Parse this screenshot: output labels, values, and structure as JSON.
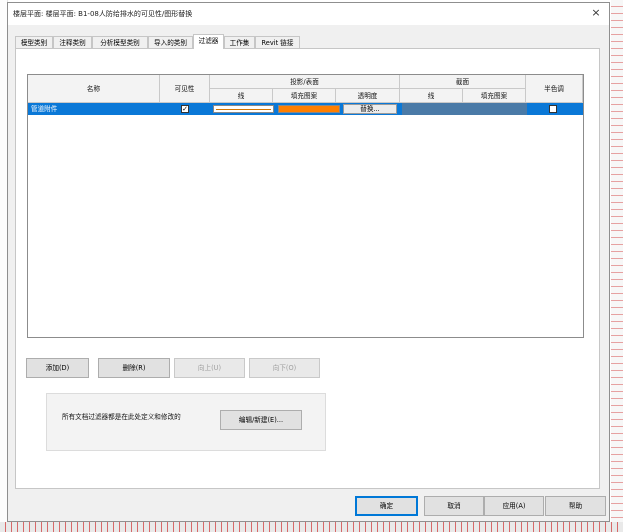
{
  "window": {
    "title": "楼层平面: 楼层平面: B1-08人防给排水的可见性/图形替换",
    "close_label": "×"
  },
  "tabs": [
    {
      "label": "模型类别",
      "active": false
    },
    {
      "label": "注释类别",
      "active": false
    },
    {
      "label": "分析模型类别",
      "active": false
    },
    {
      "label": "导入的类别",
      "active": false
    },
    {
      "label": "过滤器",
      "active": true
    },
    {
      "label": "工作集",
      "active": false
    },
    {
      "label": "Revit 链接",
      "active": false
    }
  ],
  "table": {
    "headers": {
      "name": "名称",
      "visibility": "可见性",
      "projection_surface": "投影/表面",
      "cut": "截面",
      "halftone": "半色调",
      "proj_line": "线",
      "proj_fill": "填充图案",
      "transparency": "透明度",
      "cut_line": "线",
      "cut_fill": "填充图案"
    },
    "rows": [
      {
        "name": "管道附件",
        "visible_mark": "✓",
        "proj_line_color": "#d47500",
        "proj_fill_color": "#ff7f00",
        "override_label": "替换...",
        "halftone_mark": ""
      }
    ]
  },
  "buttons": {
    "add": "添加(D)",
    "delete": "删除(R)",
    "up": "向上(U)",
    "down": "向下(O)",
    "edit_new": "编辑/新建(E)...",
    "ok": "确定",
    "cancel": "取消",
    "apply": "应用(A)",
    "help": "帮助"
  },
  "info_text": "所有文档过滤器都是在此处定义和修改的",
  "colors": {
    "selection": "#0a78d7",
    "cut_area": "#4a7aa7",
    "accent": "#0078d7"
  }
}
